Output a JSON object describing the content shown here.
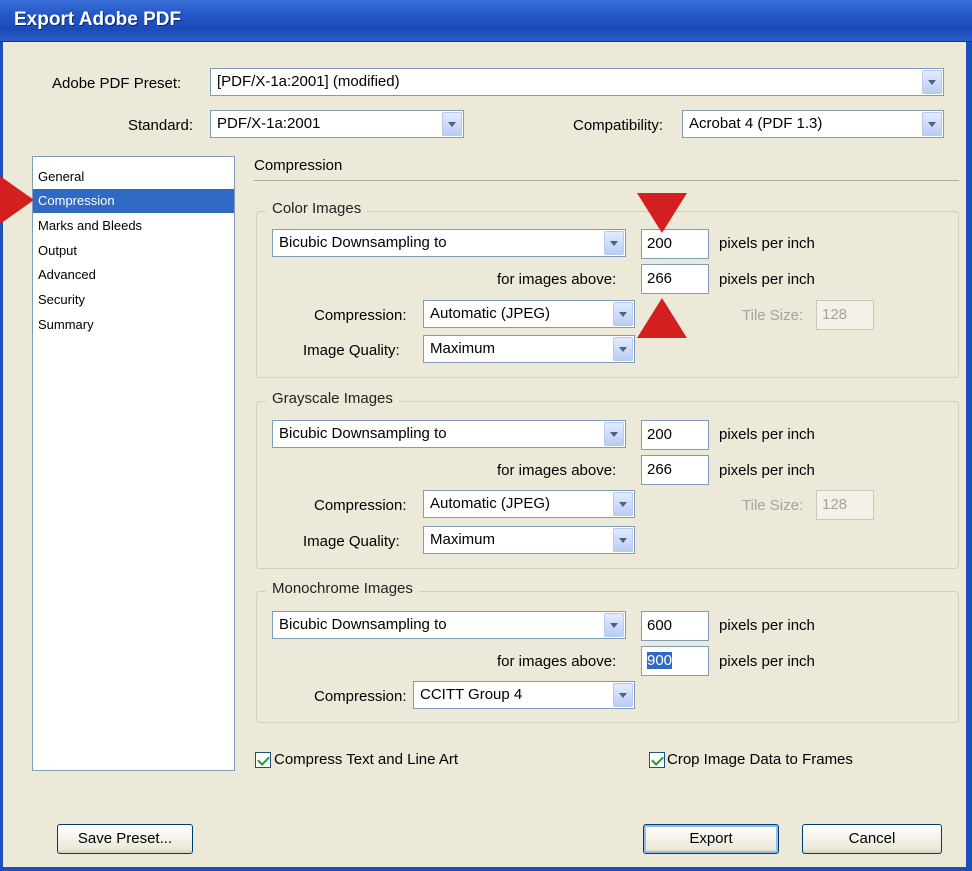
{
  "window": {
    "title": "Export Adobe PDF"
  },
  "top": {
    "preset_label": "Adobe PDF Preset:",
    "preset_value": "[PDF/X-1a:2001] (modified)",
    "standard_label": "Standard:",
    "standard_value": "PDF/X-1a:2001",
    "compatibility_label": "Compatibility:",
    "compatibility_value": "Acrobat 4 (PDF 1.3)"
  },
  "sidebar": {
    "items": [
      {
        "label": "General"
      },
      {
        "label": "Compression"
      },
      {
        "label": "Marks and Bleeds"
      },
      {
        "label": "Output"
      },
      {
        "label": "Advanced"
      },
      {
        "label": "Security"
      },
      {
        "label": "Summary"
      }
    ],
    "selected": "Compression"
  },
  "panel": {
    "title": "Compression",
    "color": {
      "title": "Color Images",
      "sampling": "Bicubic Downsampling to",
      "ppi": "200",
      "ppi_unit": "pixels per inch",
      "above_label": "for images above:",
      "above": "266",
      "above_unit": "pixels per inch",
      "compression_label": "Compression:",
      "compression": "Automatic (JPEG)",
      "tile_label": "Tile Size:",
      "tile": "128",
      "quality_label": "Image Quality:",
      "quality": "Maximum"
    },
    "gray": {
      "title": "Grayscale Images",
      "sampling": "Bicubic Downsampling to",
      "ppi": "200",
      "ppi_unit": "pixels per inch",
      "above_label": "for images above:",
      "above": "266",
      "above_unit": "pixels per inch",
      "compression_label": "Compression:",
      "compression": "Automatic (JPEG)",
      "tile_label": "Tile Size:",
      "tile": "128",
      "quality_label": "Image Quality:",
      "quality": "Maximum"
    },
    "mono": {
      "title": "Monochrome Images",
      "sampling": "Bicubic Downsampling to",
      "ppi": "600",
      "ppi_unit": "pixels per inch",
      "above_label": "for images above:",
      "above": "900",
      "above_unit": "pixels per inch",
      "compression_label": "Compression:",
      "compression": "CCITT Group 4"
    },
    "compress_text": "Compress Text and Line Art",
    "crop_image": "Crop Image Data to Frames"
  },
  "buttons": {
    "save_preset": "Save Preset...",
    "export": "Export",
    "cancel": "Cancel"
  },
  "colors": {
    "title_bar": "#2458c8",
    "selection": "#316ac5",
    "annotation": "#d31f1f"
  }
}
